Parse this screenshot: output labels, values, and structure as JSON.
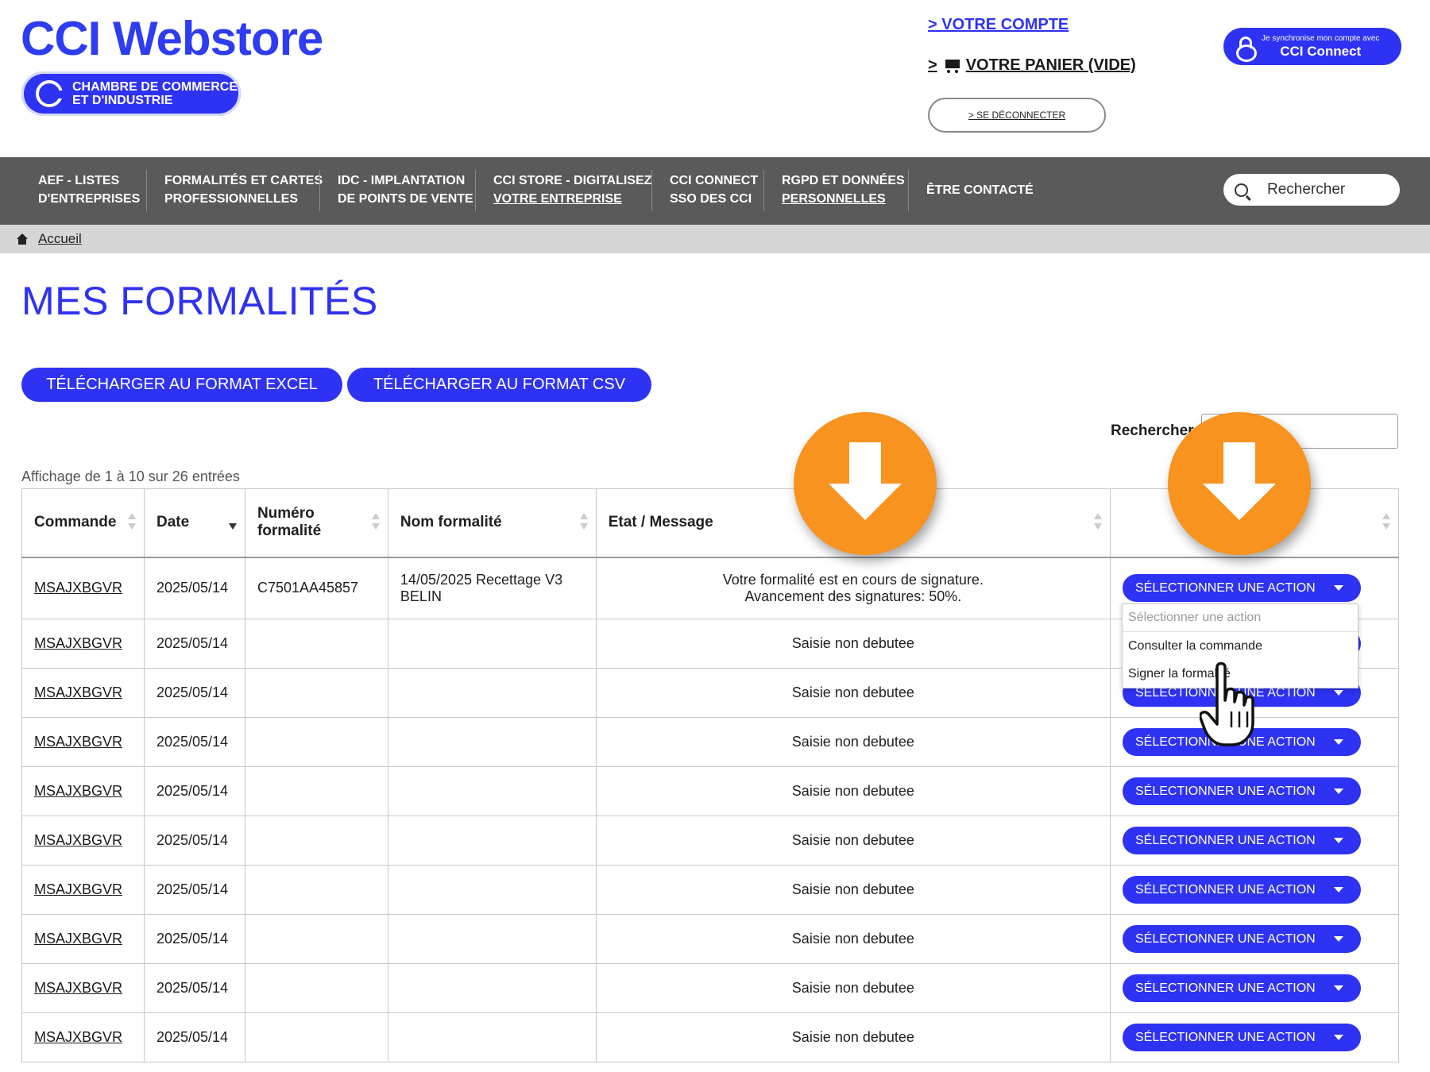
{
  "header": {
    "logo_title": "CCI Webstore",
    "badge_line1": "CHAMBRE DE COMMERCE",
    "badge_line2": "ET D'INDUSTRIE",
    "account_link": "> VOTRE COMPTE",
    "cart_prefix": ">",
    "cart_label": "VOTRE PANIER (VIDE)",
    "logout_label": "> SE DÉCONNECTER",
    "cci_connect_small": "Je synchronise mon compte avec",
    "cci_connect_big": "CCI Connect"
  },
  "nav": {
    "items": [
      {
        "line1": "AEF - LISTES",
        "line2": "D'ENTREPRISES"
      },
      {
        "line1": "FORMALITÉS ET CARTES",
        "line2": "PROFESSIONNELLES"
      },
      {
        "line1": "IDC - IMPLANTATION",
        "line2": "DE POINTS DE VENTE"
      },
      {
        "line1": "CCI STORE - DIGITALISEZ",
        "line2": "VOTRE ENTREPRISE"
      },
      {
        "line1": "CCI CONNECT",
        "line2": "SSO DES CCI"
      },
      {
        "line1": "RGPD ET DONNÉES",
        "line2": "PERSONNELLES"
      },
      {
        "line1": "ÊTRE CONTACTÉ",
        "line2": ""
      }
    ],
    "search_placeholder": "Rechercher"
  },
  "breadcrumb": {
    "home": "Accueil"
  },
  "page": {
    "title": "MES FORMALITÉS",
    "btn_excel": "TÉLÉCHARGER AU FORMAT EXCEL",
    "btn_csv": "TÉLÉCHARGER AU FORMAT CSV",
    "search_label": "Rechercher :",
    "entries_info": "Affichage de 1 à 10 sur 26 entrées"
  },
  "table": {
    "headers": {
      "commande": "Commande",
      "date": "Date",
      "numero_line1": "Numéro",
      "numero_line2": "formalité",
      "nom": "Nom formalité",
      "etat": "Etat / Message"
    },
    "action_label": "SÉLECTIONNER UNE ACTION",
    "rows": [
      {
        "commande": "MSAJXBGVR",
        "date": "2025/05/14",
        "numero": "C7501AA45857",
        "nom_line1": "14/05/2025 Recettage V3",
        "nom_line2": "BELIN",
        "etat_line1": "Votre formalité est en cours de signature.",
        "etat_line2": "Avancement des signatures: 50%."
      },
      {
        "commande": "MSAJXBGVR",
        "date": "2025/05/14",
        "numero": "",
        "nom_line1": "",
        "nom_line2": "",
        "etat_line1": "Saisie non debutee",
        "etat_line2": ""
      },
      {
        "commande": "MSAJXBGVR",
        "date": "2025/05/14",
        "numero": "",
        "nom_line1": "",
        "nom_line2": "",
        "etat_line1": "Saisie non debutee",
        "etat_line2": ""
      },
      {
        "commande": "MSAJXBGVR",
        "date": "2025/05/14",
        "numero": "",
        "nom_line1": "",
        "nom_line2": "",
        "etat_line1": "Saisie non debutee",
        "etat_line2": ""
      },
      {
        "commande": "MSAJXBGVR",
        "date": "2025/05/14",
        "numero": "",
        "nom_line1": "",
        "nom_line2": "",
        "etat_line1": "Saisie non debutee",
        "etat_line2": ""
      },
      {
        "commande": "MSAJXBGVR",
        "date": "2025/05/14",
        "numero": "",
        "nom_line1": "",
        "nom_line2": "",
        "etat_line1": "Saisie non debutee",
        "etat_line2": ""
      },
      {
        "commande": "MSAJXBGVR",
        "date": "2025/05/14",
        "numero": "",
        "nom_line1": "",
        "nom_line2": "",
        "etat_line1": "Saisie non debutee",
        "etat_line2": ""
      },
      {
        "commande": "MSAJXBGVR",
        "date": "2025/05/14",
        "numero": "",
        "nom_line1": "",
        "nom_line2": "",
        "etat_line1": "Saisie non debutee",
        "etat_line2": ""
      },
      {
        "commande": "MSAJXBGVR",
        "date": "2025/05/14",
        "numero": "",
        "nom_line1": "",
        "nom_line2": "",
        "etat_line1": "Saisie non debutee",
        "etat_line2": ""
      },
      {
        "commande": "MSAJXBGVR",
        "date": "2025/05/14",
        "numero": "",
        "nom_line1": "",
        "nom_line2": "",
        "etat_line1": "Saisie non debutee",
        "etat_line2": ""
      }
    ]
  },
  "dropdown": {
    "options": [
      "Sélectionner une action",
      "Consulter la commande",
      "Signer la formalité"
    ]
  },
  "colors": {
    "brand_blue": "#2e32f2",
    "nav_grey": "#5a5a5a",
    "callout_orange": "#f7931e"
  },
  "icons": [
    "cci-logo-icon",
    "cart-icon",
    "lock-icon",
    "search-icon",
    "home-icon",
    "sort-icon",
    "caret-down-icon",
    "down-arrow-icon",
    "hand-pointer-icon"
  ]
}
